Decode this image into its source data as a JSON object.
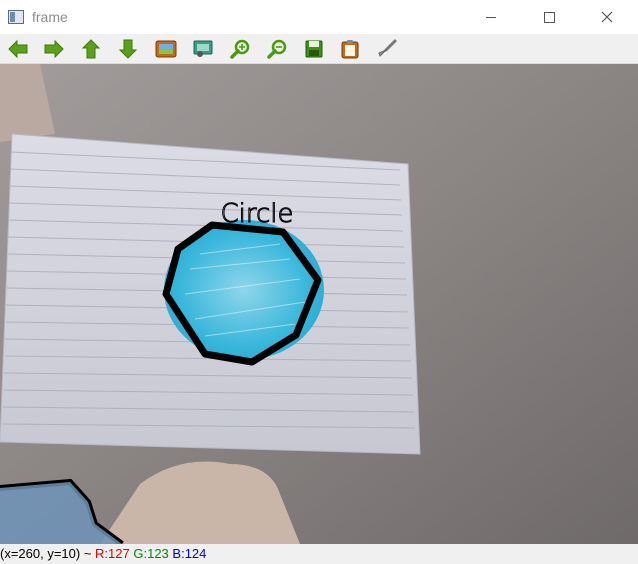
{
  "window": {
    "title": "frame"
  },
  "toolbar": {
    "buttons": [
      {
        "name": "pan-left",
        "icon": "arrow-left-icon"
      },
      {
        "name": "pan-right",
        "icon": "arrow-right-icon"
      },
      {
        "name": "pan-up",
        "icon": "arrow-up-icon"
      },
      {
        "name": "pan-down",
        "icon": "arrow-down-icon"
      },
      {
        "name": "zoom-to-fit",
        "icon": "image-icon"
      },
      {
        "name": "zoom-to-original",
        "icon": "image-zoom-icon"
      },
      {
        "name": "zoom-in",
        "icon": "zoom-in-icon"
      },
      {
        "name": "zoom-out",
        "icon": "zoom-out-icon"
      },
      {
        "name": "save-image",
        "icon": "save-icon"
      },
      {
        "name": "copy-to-clipboard",
        "icon": "clipboard-icon"
      },
      {
        "name": "properties",
        "icon": "brush-icon"
      }
    ],
    "colors": {
      "arrow": "#5a9e1a",
      "magnifier": "#4c9a12",
      "save": "#3f8f1a",
      "image": "#b8641a"
    }
  },
  "frame": {
    "detected_label": "Circle"
  },
  "status": {
    "coords": "(x=260, y=10) ~ ",
    "r": "R:127",
    "g": "G:123",
    "b": "B:124"
  }
}
